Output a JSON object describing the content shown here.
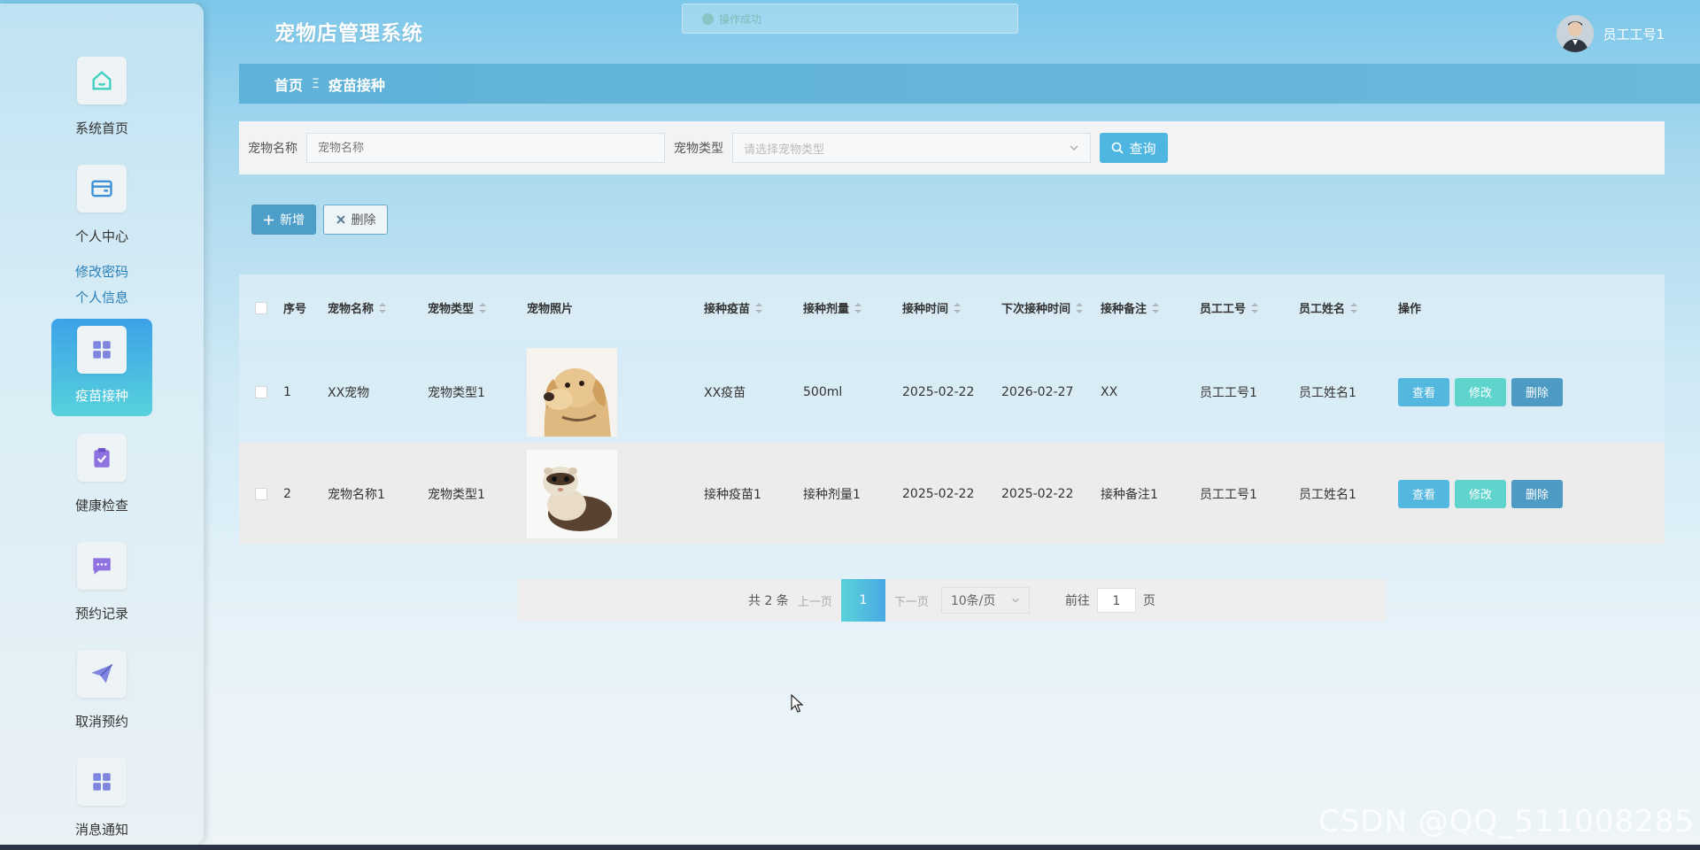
{
  "app": {
    "title": "宠物店管理系统",
    "user": "员工工号1"
  },
  "toast": {
    "text": "操作成功"
  },
  "sidebar": {
    "items": [
      {
        "label": "系统首页",
        "icon": "home-icon"
      },
      {
        "label": "个人中心",
        "icon": "wallet-icon"
      },
      {
        "label": "疫苗接种",
        "icon": "grid-icon"
      },
      {
        "label": "健康检查",
        "icon": "clipboard-icon"
      },
      {
        "label": "预约记录",
        "icon": "message-icon"
      },
      {
        "label": "取消预约",
        "icon": "send-icon"
      },
      {
        "label": "消息通知",
        "icon": "grid-icon"
      }
    ],
    "sub": [
      "修改密码",
      "个人信息"
    ]
  },
  "breadcrumb": {
    "home": "首页",
    "sep": "Ξ",
    "current": "疫苗接种"
  },
  "search": {
    "name_label": "宠物名称",
    "name_placeholder": "宠物名称",
    "type_label": "宠物类型",
    "type_placeholder": "请选择宠物类型",
    "query_label": "查询"
  },
  "actions": {
    "add": "新增",
    "delete": "删除"
  },
  "table": {
    "headers": [
      "序号",
      "宠物名称",
      "宠物类型",
      "宠物照片",
      "接种疫苗",
      "接种剂量",
      "接种时间",
      "下次接种时间",
      "接种备注",
      "员工工号",
      "员工姓名",
      "操作"
    ],
    "rows": [
      {
        "no": "1",
        "name": "XX宠物",
        "type": "宠物类型1",
        "vaccine": "XX疫苗",
        "dose": "500ml",
        "time": "2025-02-22",
        "next": "2026-02-27",
        "remark": "XX",
        "emp_no": "员工工号1",
        "emp_name": "员工姓名1"
      },
      {
        "no": "2",
        "name": "宠物名称1",
        "type": "宠物类型1",
        "vaccine": "接种疫苗1",
        "dose": "接种剂量1",
        "time": "2025-02-22",
        "next": "2025-02-22",
        "remark": "接种备注1",
        "emp_no": "员工工号1",
        "emp_name": "员工姓名1"
      }
    ],
    "ops": {
      "view": "查看",
      "edit": "修改",
      "del": "删除"
    }
  },
  "pager": {
    "total": "共 2 条",
    "prev": "上一页",
    "current": "1",
    "next": "下一页",
    "size": "10条/页",
    "goto": "前往",
    "goto_value": "1",
    "page_unit": "页"
  },
  "watermark": "CSDN @QQ_511008285"
}
